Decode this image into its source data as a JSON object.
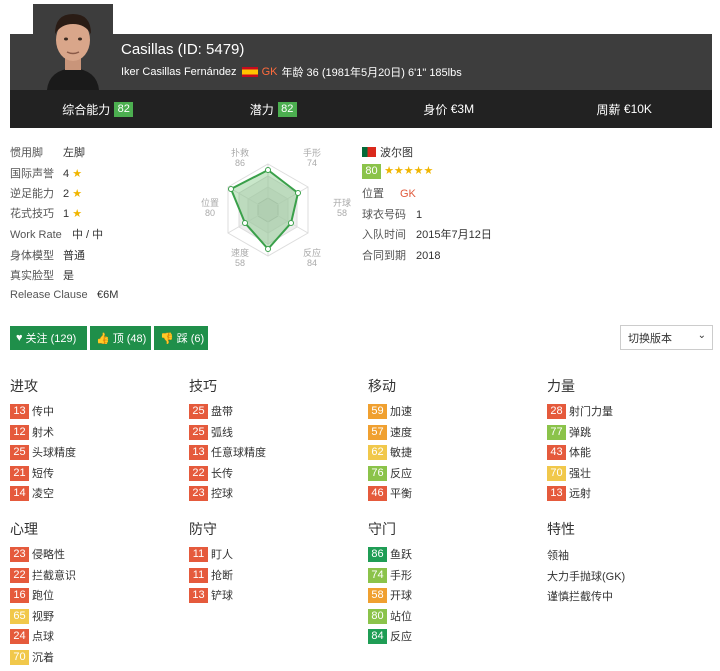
{
  "player": {
    "title": "Casillas (ID: 5479)",
    "full_name": "Iker Casillas Fernández",
    "position": "GK",
    "details": "年龄 36 (1981年5月20日) 6'1\" 185lbs"
  },
  "stats": [
    {
      "label": "综合能力",
      "value": "82"
    },
    {
      "label": "潜力",
      "value": "82"
    },
    {
      "label": "身价",
      "value": "€3M"
    },
    {
      "label": "周薪",
      "value": "€10K"
    }
  ],
  "info_left": [
    {
      "key": "惯用脚",
      "value": "左脚"
    },
    {
      "key": "国际声誉",
      "value": "4"
    },
    {
      "key": "逆足能力",
      "value": "2"
    },
    {
      "key": "花式技巧",
      "value": "1"
    },
    {
      "key": "Work Rate",
      "value": "中 / 中"
    },
    {
      "key": "身体模型",
      "value": "普通"
    },
    {
      "key": "真实脸型",
      "value": "是"
    },
    {
      "key": "Release Clause",
      "value": "€6M"
    }
  ],
  "radar": {
    "labels": [
      {
        "name": "扑救",
        "value": "86"
      },
      {
        "name": "手形",
        "value": "74"
      },
      {
        "name": "开球",
        "value": "58"
      },
      {
        "name": "反应",
        "value": "84"
      },
      {
        "name": "速度",
        "value": "58"
      },
      {
        "name": "位置",
        "value": "80"
      }
    ]
  },
  "club": {
    "name": "波尔图",
    "rating": "80",
    "stars": "★★★★★",
    "position_label": "位置",
    "position": "GK",
    "number_label": "球衣号码",
    "number": "1",
    "joined_label": "入队时间",
    "joined": "2015年7月12日",
    "contract_label": "合同到期",
    "contract": "2018"
  },
  "actions": {
    "follow": "关注 (129)",
    "like": "顶 (48)",
    "dislike": "踩 (6)",
    "version": "切换版本"
  },
  "sections": {
    "attack": {
      "title": "进攻",
      "items": [
        {
          "v": "13",
          "n": "传中"
        },
        {
          "v": "12",
          "n": "射术"
        },
        {
          "v": "25",
          "n": "头球精度"
        },
        {
          "v": "21",
          "n": "短传"
        },
        {
          "v": "14",
          "n": "凌空"
        }
      ]
    },
    "skill": {
      "title": "技巧",
      "items": [
        {
          "v": "25",
          "n": "盘带"
        },
        {
          "v": "25",
          "n": "弧线"
        },
        {
          "v": "13",
          "n": "任意球精度"
        },
        {
          "v": "22",
          "n": "长传"
        },
        {
          "v": "23",
          "n": "控球"
        }
      ]
    },
    "movement": {
      "title": "移动",
      "items": [
        {
          "v": "59",
          "n": "加速"
        },
        {
          "v": "57",
          "n": "速度"
        },
        {
          "v": "62",
          "n": "敏捷"
        },
        {
          "v": "76",
          "n": "反应"
        },
        {
          "v": "46",
          "n": "平衡"
        }
      ]
    },
    "power": {
      "title": "力量",
      "items": [
        {
          "v": "28",
          "n": "射门力量"
        },
        {
          "v": "77",
          "n": "弹跳"
        },
        {
          "v": "43",
          "n": "体能"
        },
        {
          "v": "70",
          "n": "强壮"
        },
        {
          "v": "13",
          "n": "远射"
        }
      ]
    },
    "mentality": {
      "title": "心理",
      "items": [
        {
          "v": "23",
          "n": "侵略性"
        },
        {
          "v": "22",
          "n": "拦截意识"
        },
        {
          "v": "16",
          "n": "跑位"
        },
        {
          "v": "65",
          "n": "视野"
        },
        {
          "v": "24",
          "n": "点球"
        },
        {
          "v": "70",
          "n": "沉着"
        }
      ]
    },
    "defending": {
      "title": "防守",
      "items": [
        {
          "v": "11",
          "n": "盯人"
        },
        {
          "v": "11",
          "n": "抢断"
        },
        {
          "v": "13",
          "n": "铲球"
        }
      ]
    },
    "goalkeeping": {
      "title": "守门",
      "items": [
        {
          "v": "86",
          "n": "鱼跃"
        },
        {
          "v": "74",
          "n": "手形"
        },
        {
          "v": "58",
          "n": "开球"
        },
        {
          "v": "80",
          "n": "站位"
        },
        {
          "v": "84",
          "n": "反应"
        }
      ]
    },
    "traits": {
      "title": "特性",
      "items": [
        "领袖",
        "大力手抛球(GK)",
        "谨慎拦截传中"
      ]
    }
  }
}
